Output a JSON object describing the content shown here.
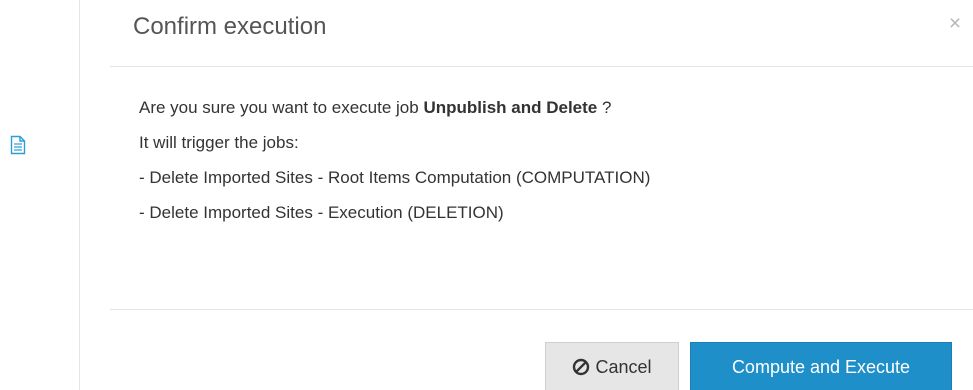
{
  "dialog": {
    "title": "Confirm execution",
    "close_label": "×",
    "body": {
      "question_prefix": "Are you sure you want to execute job ",
      "job_name": "Unpublish and Delete",
      "question_suffix": " ?",
      "trigger_intro": "It will trigger the jobs:",
      "jobs": [
        "- Delete Imported Sites - Root Items Computation (COMPUTATION)",
        "- Delete Imported Sites - Execution (DELETION)"
      ]
    },
    "footer": {
      "cancel_label": "Cancel",
      "execute_label": "Compute and Execute"
    }
  },
  "icons": {
    "left_doc_icon": "document-icon",
    "cancel_icon": "ban-icon",
    "close_icon": "close-icon"
  },
  "colors": {
    "primary": "#1f8fc9",
    "secondary_button": "#e6e6e6",
    "doc_icon": "#2a9fd6"
  }
}
